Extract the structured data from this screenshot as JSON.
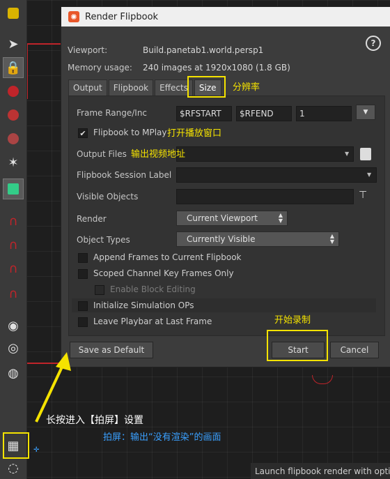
{
  "dialog": {
    "title": "Render Flipbook",
    "viewport_label": "Viewport:",
    "viewport_value": "Build.panetab1.world.persp1",
    "memory_label": "Memory usage:",
    "memory_value": "240 images at 1920x1080 (1.8 GB)",
    "help": "?"
  },
  "tabs": [
    "Output",
    "Flipbook",
    "Effects",
    "Size"
  ],
  "form": {
    "frame_range_label": "Frame Range/Inc",
    "frame_start": "$RFSTART",
    "frame_end": "$RFEND",
    "frame_inc": "1",
    "flipbook_mplay_label": "Flipbook to MPlay",
    "flipbook_mplay_checked": true,
    "output_files_label": "Output Files",
    "output_files_value": "",
    "session_label": "Flipbook Session Label",
    "visible_objects_label": "Visible Objects",
    "render_label": "Render",
    "render_value": "Current Viewport",
    "object_types_label": "Object Types",
    "object_types_value": "Currently Visible",
    "append_frames": "Append Frames to Current Flipbook",
    "scoped_channel": "Scoped Channel Key Frames Only",
    "enable_block": "Enable Block Editing",
    "init_sim": "Initialize Simulation OPs",
    "leave_playbar": "Leave Playbar at Last Frame"
  },
  "buttons": {
    "save_default": "Save as Default",
    "start": "Start",
    "cancel": "Cancel"
  },
  "annotations": {
    "resolution": "分辨率",
    "open_window": "打开播放窗口",
    "output_path": "输出视频地址",
    "start_record": "开始录制",
    "long_press": "长按进入【拍屏】设置",
    "explain": "拍屏：输出“没有渲染”的画面"
  },
  "status": "Launch flipbook render with options",
  "colors": {
    "highlight": "#f5e300",
    "accent_blue": "#3aa0ff",
    "red": "#c0242a"
  }
}
